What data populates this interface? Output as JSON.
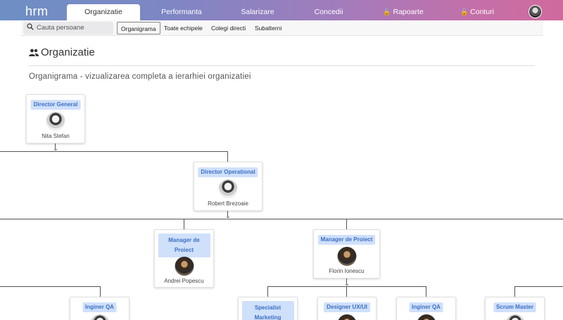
{
  "app": {
    "logo": "hrm"
  },
  "nav": {
    "tabs": [
      {
        "label": "Organizatie",
        "active": true
      },
      {
        "label": "Performanta"
      },
      {
        "label": "Salarizare"
      },
      {
        "label": "Concedii"
      },
      {
        "label": "Rapoarte",
        "icon": "lock-icon"
      },
      {
        "label": "Conturi",
        "icon": "lock-icon"
      }
    ]
  },
  "search": {
    "placeholder": "Cauta persoane"
  },
  "subnav": [
    {
      "label": "Organigrama",
      "active": true
    },
    {
      "label": "Toate echipele"
    },
    {
      "label": "Colegi directi"
    },
    {
      "label": "Subalterni"
    }
  ],
  "page": {
    "title": "Organizatie",
    "subtitle": "Organigrama - vizualizarea completa a ierarhiei organizatiei"
  },
  "org": {
    "cards": [
      {
        "role": "Director General",
        "name": "Nita Stefan"
      },
      {
        "role": "Director Operational",
        "name": "Robert Brezoaie"
      },
      {
        "role": "Manager de Proiect",
        "name": "Andrei Popescu"
      },
      {
        "role": "Manager de Proiect",
        "name": "Florin Ionescu"
      },
      {
        "role": "Inginer QA",
        "name": ""
      },
      {
        "role": "Specialist Marketing",
        "name": ""
      },
      {
        "role": "Designer UX/UI",
        "name": ""
      },
      {
        "role": "Inginer QA",
        "name": ""
      },
      {
        "role": "Scrum Master",
        "name": ""
      }
    ]
  },
  "colors": {
    "accent": "#3b6fc4",
    "role_bg": "#cfe0fb"
  }
}
